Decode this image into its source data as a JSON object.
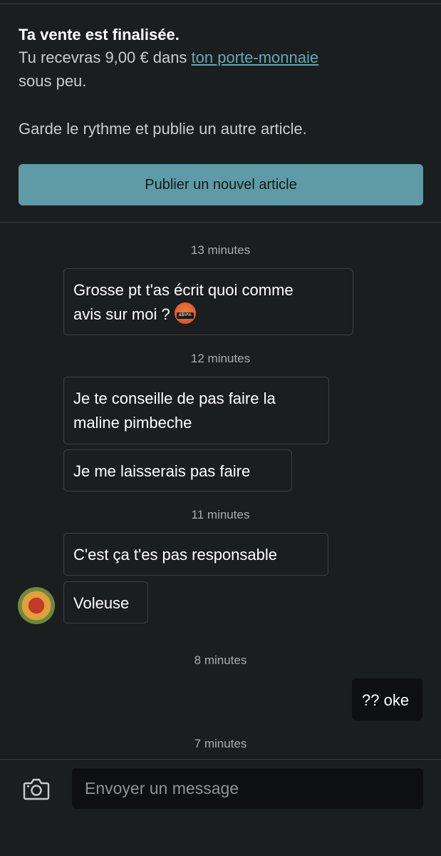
{
  "notice": {
    "title": "Ta vente est finalisée.",
    "body_prefix": "Tu recevras 9,00 € dans ",
    "wallet_link": "ton porte-monnaie",
    "body_suffix": "sous peu.",
    "cta_text": "Garde le rythme et publie un autre article.",
    "publish_button": "Publier un nouvel article"
  },
  "messages": [
    {
      "time": "13 minutes"
    },
    {
      "text_1": "Grosse pt t'as écrit quoi comme",
      "text_2": "avis sur moi ?"
    },
    {
      "time": "12 minutes"
    },
    {
      "text_1": "Je te conseille de pas faire la",
      "text_2": "maline pimbeche"
    },
    {
      "text": "Je me laisserais pas faire"
    },
    {
      "time": "11 minutes"
    },
    {
      "text": "C'est ça t'es pas responsable"
    },
    {
      "text": "Voleuse"
    },
    {
      "time": "8 minutes"
    },
    {
      "text": "?? oke"
    },
    {
      "time": "7 minutes"
    }
  ],
  "composer": {
    "placeholder": "Envoyer un message"
  },
  "icons": {
    "emoji": "swearing-face-emoji-icon",
    "camera": "camera-icon"
  },
  "colors": {
    "background": "#1b1e1f",
    "accent": "#5e9ba6",
    "link": "#63a7b2",
    "own_bubble": "#0d0f10"
  }
}
